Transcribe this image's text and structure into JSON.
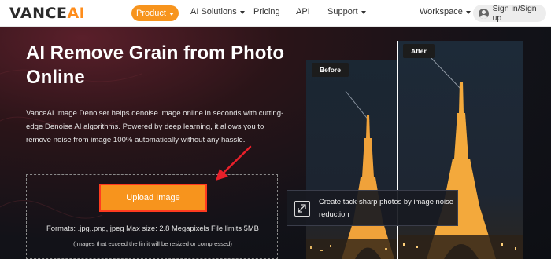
{
  "header": {
    "logo_main": "VANCE",
    "logo_accent": "AI",
    "nav": {
      "product": "Product",
      "ai_solutions": "AI Solutions",
      "pricing": "Pricing",
      "api": "API",
      "support": "Support",
      "workspace": "Workspace"
    },
    "signin_label": "Sign in/Sign up"
  },
  "hero": {
    "title": "AI Remove Grain from Photo Online",
    "description": "VanceAI Image Denoiser helps denoise image online in seconds with cutting-edge Denoise AI algorithms. Powered by deep learning, it allows you to remove noise from image 100% automatically without any hassle.",
    "upload_button": "Upload Image",
    "formats": "Formats: .jpg,.png,.jpeg Max size: 2.8 Megapixels File limits 5MB",
    "resize_note": "(Images that exceed the limit will be resized or compressed)"
  },
  "comparison": {
    "before_label": "Before",
    "after_label": "After"
  },
  "feature": {
    "text": "Create tack-sharp photos by image noise reduction"
  },
  "colors": {
    "accent": "#f7941d",
    "highlight": "#ff3b1f"
  }
}
